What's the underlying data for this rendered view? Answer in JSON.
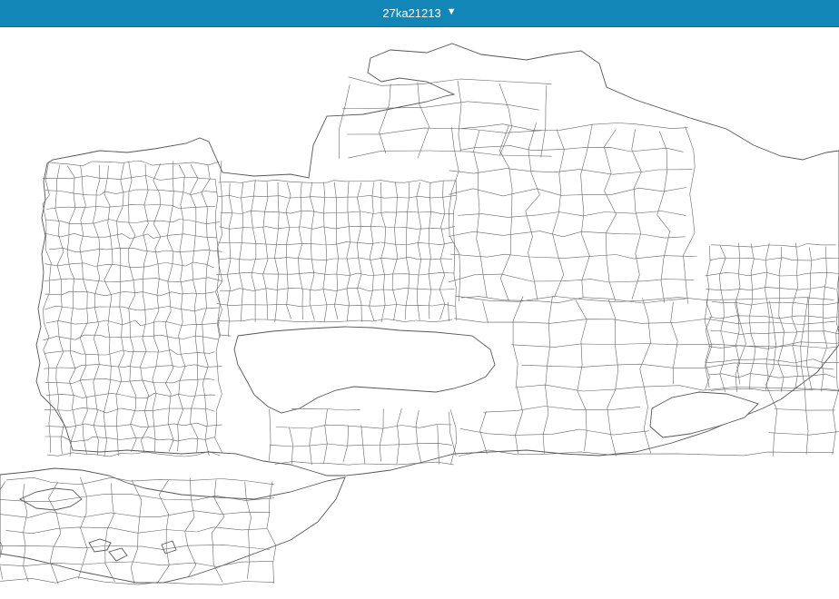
{
  "header": {
    "region_code": "27ka21213",
    "dropdown_icon": "triangle-down-icon"
  },
  "colors": {
    "header_bg": "#1386b8",
    "header_text": "#ffffff",
    "map_bg": "#ffffff",
    "boundary_stroke": "#555555"
  }
}
